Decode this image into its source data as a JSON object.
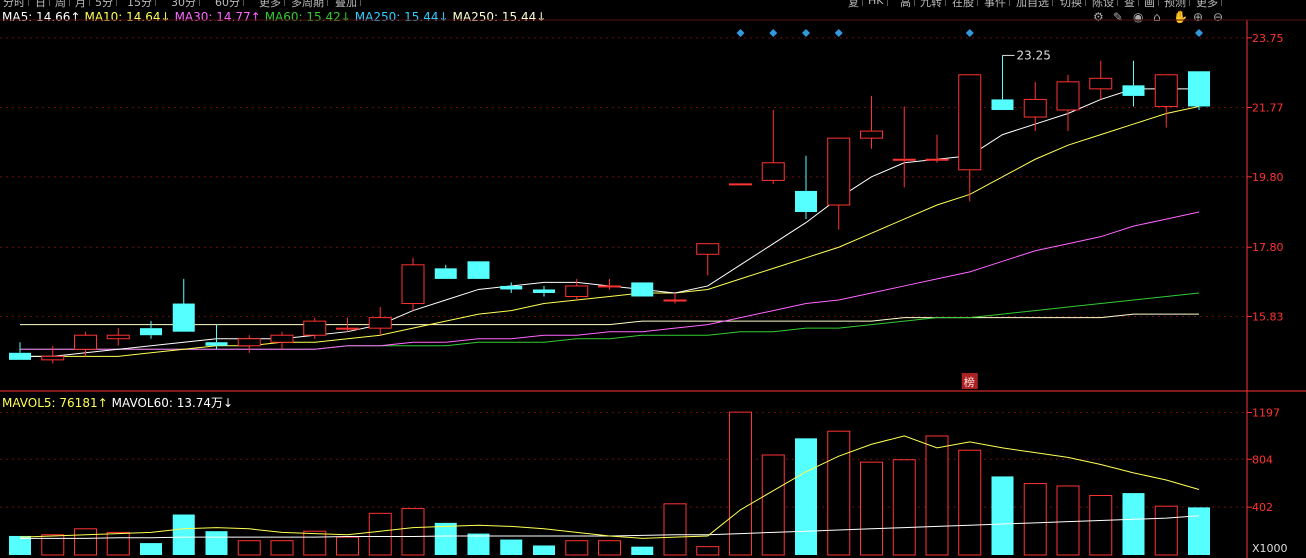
{
  "toolbar": {
    "left_tabs": [
      "分时",
      "日",
      "周",
      "月",
      "5分",
      "15分",
      "30分",
      "60分",
      "更多",
      "多周期",
      "叠加"
    ],
    "right_tabs": [
      "复",
      "HK",
      "高",
      "九转",
      "在股",
      "事件",
      "加自选",
      "切换",
      "陈设",
      "查",
      "画",
      "预测",
      "更多"
    ]
  },
  "legend": {
    "ma": [
      {
        "label": "MA5: 14.66",
        "arrow": "↑",
        "color": "#ffffff"
      },
      {
        "label": "MA10: 14.64",
        "arrow": "↓",
        "color": "#ffff55"
      },
      {
        "label": "MA30: 14.77",
        "arrow": "↑",
        "color": "#ff66ff"
      },
      {
        "label": "MA60: 15.42",
        "arrow": "↓",
        "color": "#33cc33"
      },
      {
        "label": "MA250: 15.44",
        "arrow": "↓",
        "color": "#33ccff"
      },
      {
        "label": "MA250: 15.44",
        "arrow": "↓",
        "color": "#ffffcc"
      }
    ],
    "vol": [
      {
        "label": "MAVOL5: 76181",
        "arrow": "↑",
        "color": "#ffff55"
      },
      {
        "label": "MAVOL60: 13.74万",
        "arrow": "↓",
        "color": "#ffffff"
      }
    ]
  },
  "tools": [
    {
      "name": "settings-icon",
      "glyph": "⚙"
    },
    {
      "name": "pen-icon",
      "glyph": "✎"
    },
    {
      "name": "eye-icon",
      "glyph": "◉"
    },
    {
      "name": "basket-icon",
      "glyph": "⌂"
    },
    {
      "name": "hand-icon",
      "glyph": "✋"
    },
    {
      "name": "zoom-in-icon",
      "glyph": "⊕"
    },
    {
      "name": "zoom-out-icon",
      "glyph": "⊖"
    }
  ],
  "colors": {
    "up": "#ff3333",
    "down": "#55ffff",
    "axis": "#ff3333"
  },
  "chart_data": [
    {
      "type": "candlestick",
      "y_ticks": [
        "23.75",
        "21.77",
        "19.80",
        "17.80",
        "15.83"
      ],
      "ylim": [
        13.8,
        24.2
      ],
      "max_annotation": "23.25",
      "badge": "榜",
      "candles": [
        {
          "o": 14.8,
          "h": 15.1,
          "l": 14.6,
          "c": 14.6
        },
        {
          "o": 14.6,
          "h": 15.0,
          "l": 14.5,
          "c": 14.7
        },
        {
          "o": 14.9,
          "h": 15.4,
          "l": 14.7,
          "c": 15.3
        },
        {
          "o": 15.2,
          "h": 15.5,
          "l": 15.0,
          "c": 15.3
        },
        {
          "o": 15.5,
          "h": 15.7,
          "l": 15.2,
          "c": 15.3
        },
        {
          "o": 16.2,
          "h": 16.9,
          "l": 15.4,
          "c": 15.4
        },
        {
          "o": 15.1,
          "h": 15.6,
          "l": 14.9,
          "c": 15.0
        },
        {
          "o": 15.0,
          "h": 15.3,
          "l": 14.8,
          "c": 15.2
        },
        {
          "o": 15.1,
          "h": 15.4,
          "l": 14.9,
          "c": 15.3
        },
        {
          "o": 15.3,
          "h": 15.8,
          "l": 15.2,
          "c": 15.7
        },
        {
          "o": 15.5,
          "h": 15.8,
          "l": 15.4,
          "c": 15.5
        },
        {
          "o": 15.5,
          "h": 16.1,
          "l": 15.3,
          "c": 15.8
        },
        {
          "o": 16.2,
          "h": 17.5,
          "l": 16.0,
          "c": 17.3
        },
        {
          "o": 17.2,
          "h": 17.3,
          "l": 16.9,
          "c": 16.9
        },
        {
          "o": 17.4,
          "h": 17.4,
          "l": 16.9,
          "c": 16.9
        },
        {
          "o": 16.7,
          "h": 16.8,
          "l": 16.5,
          "c": 16.6
        },
        {
          "o": 16.6,
          "h": 16.7,
          "l": 16.4,
          "c": 16.5
        },
        {
          "o": 16.4,
          "h": 16.9,
          "l": 16.3,
          "c": 16.7
        },
        {
          "o": 16.7,
          "h": 16.9,
          "l": 16.6,
          "c": 16.7
        },
        {
          "o": 16.8,
          "h": 16.8,
          "l": 16.4,
          "c": 16.4
        },
        {
          "o": 16.3,
          "h": 16.5,
          "l": 16.2,
          "c": 16.3
        },
        {
          "o": 17.6,
          "h": 17.9,
          "l": 17.0,
          "c": 17.9
        },
        {
          "o": 19.6,
          "h": 19.6,
          "l": 19.6,
          "c": 19.6
        },
        {
          "o": 19.7,
          "h": 21.7,
          "l": 19.6,
          "c": 20.2
        },
        {
          "o": 19.4,
          "h": 20.4,
          "l": 18.6,
          "c": 18.8
        },
        {
          "o": 19.0,
          "h": 20.9,
          "l": 18.3,
          "c": 20.9
        },
        {
          "o": 20.9,
          "h": 22.1,
          "l": 20.6,
          "c": 21.1
        },
        {
          "o": 20.3,
          "h": 21.8,
          "l": 19.5,
          "c": 20.3
        },
        {
          "o": 20.3,
          "h": 21.0,
          "l": 20.2,
          "c": 20.3
        },
        {
          "o": 20.0,
          "h": 22.7,
          "l": 19.1,
          "c": 22.7
        },
        {
          "o": 22.0,
          "h": 23.25,
          "l": 21.7,
          "c": 21.7
        },
        {
          "o": 21.5,
          "h": 22.5,
          "l": 21.1,
          "c": 22.0
        },
        {
          "o": 21.7,
          "h": 22.7,
          "l": 21.1,
          "c": 22.5
        },
        {
          "o": 22.3,
          "h": 23.1,
          "l": 22.0,
          "c": 22.6
        },
        {
          "o": 22.4,
          "h": 23.1,
          "l": 21.8,
          "c": 22.1
        },
        {
          "o": 21.8,
          "h": 22.7,
          "l": 21.2,
          "c": 22.7
        },
        {
          "o": 22.8,
          "h": 22.8,
          "l": 21.7,
          "c": 21.8
        }
      ],
      "ma5": [
        14.7,
        14.7,
        14.8,
        14.9,
        15.0,
        15.1,
        15.2,
        15.2,
        15.2,
        15.3,
        15.4,
        15.6,
        16.0,
        16.3,
        16.6,
        16.7,
        16.8,
        16.8,
        16.7,
        16.6,
        16.5,
        16.7,
        17.3,
        17.9,
        18.5,
        19.2,
        19.8,
        20.2,
        20.3,
        20.4,
        21.0,
        21.3,
        21.6,
        22.0,
        22.3,
        22.3,
        22.3
      ],
      "ma10": [
        14.7,
        14.7,
        14.7,
        14.7,
        14.8,
        14.9,
        15.0,
        15.0,
        15.1,
        15.1,
        15.2,
        15.3,
        15.5,
        15.7,
        15.9,
        16.0,
        16.2,
        16.3,
        16.4,
        16.5,
        16.5,
        16.6,
        16.9,
        17.2,
        17.5,
        17.8,
        18.2,
        18.6,
        19.0,
        19.3,
        19.8,
        20.3,
        20.7,
        21.0,
        21.3,
        21.6,
        21.8
      ],
      "ma30": [
        14.9,
        14.9,
        14.9,
        14.9,
        14.9,
        14.9,
        14.9,
        14.9,
        14.9,
        14.9,
        15.0,
        15.0,
        15.1,
        15.1,
        15.2,
        15.2,
        15.3,
        15.3,
        15.4,
        15.4,
        15.5,
        15.6,
        15.8,
        16.0,
        16.2,
        16.3,
        16.5,
        16.7,
        16.9,
        17.1,
        17.4,
        17.7,
        17.9,
        18.1,
        18.4,
        18.6,
        18.8
      ],
      "ma60": [
        14.9,
        14.9,
        14.9,
        14.9,
        14.9,
        14.9,
        14.9,
        14.9,
        14.9,
        14.9,
        15.0,
        15.0,
        15.0,
        15.0,
        15.1,
        15.1,
        15.1,
        15.2,
        15.2,
        15.3,
        15.3,
        15.3,
        15.4,
        15.4,
        15.5,
        15.5,
        15.6,
        15.7,
        15.8,
        15.8,
        15.9,
        16.0,
        16.1,
        16.2,
        16.3,
        16.4,
        16.5
      ],
      "ma250": [
        15.6,
        15.6,
        15.6,
        15.6,
        15.6,
        15.6,
        15.6,
        15.6,
        15.6,
        15.6,
        15.6,
        15.6,
        15.6,
        15.6,
        15.6,
        15.6,
        15.6,
        15.6,
        15.6,
        15.7,
        15.7,
        15.7,
        15.7,
        15.7,
        15.7,
        15.7,
        15.7,
        15.8,
        15.8,
        15.8,
        15.8,
        15.8,
        15.8,
        15.8,
        15.9,
        15.9,
        15.9
      ],
      "markers_on": [
        22,
        23,
        24,
        25,
        29,
        36
      ]
    },
    {
      "type": "bar",
      "y_ticks": [
        "1197",
        "804",
        "402",
        "X1000"
      ],
      "ylim": [
        0,
        1260
      ],
      "volumes": [
        160,
        170,
        220,
        190,
        100,
        340,
        200,
        120,
        120,
        200,
        150,
        350,
        390,
        270,
        180,
        130,
        80,
        120,
        120,
        70,
        430,
        70,
        1200,
        840,
        980,
        1040,
        780,
        800,
        1000,
        880,
        660,
        600,
        580,
        500,
        520,
        410,
        400
      ],
      "mavol5": [
        150,
        160,
        170,
        180,
        190,
        220,
        230,
        220,
        190,
        180,
        170,
        200,
        230,
        240,
        250,
        240,
        220,
        190,
        160,
        140,
        150,
        160,
        380,
        540,
        700,
        830,
        930,
        1000,
        900,
        950,
        900,
        860,
        820,
        760,
        690,
        630,
        550
      ],
      "mavol60": [
        140,
        140,
        140,
        145,
        145,
        150,
        150,
        150,
        150,
        150,
        155,
        155,
        155,
        160,
        160,
        160,
        160,
        160,
        160,
        165,
        170,
        170,
        180,
        190,
        200,
        210,
        220,
        230,
        240,
        250,
        260,
        270,
        280,
        290,
        300,
        310,
        330
      ]
    }
  ]
}
